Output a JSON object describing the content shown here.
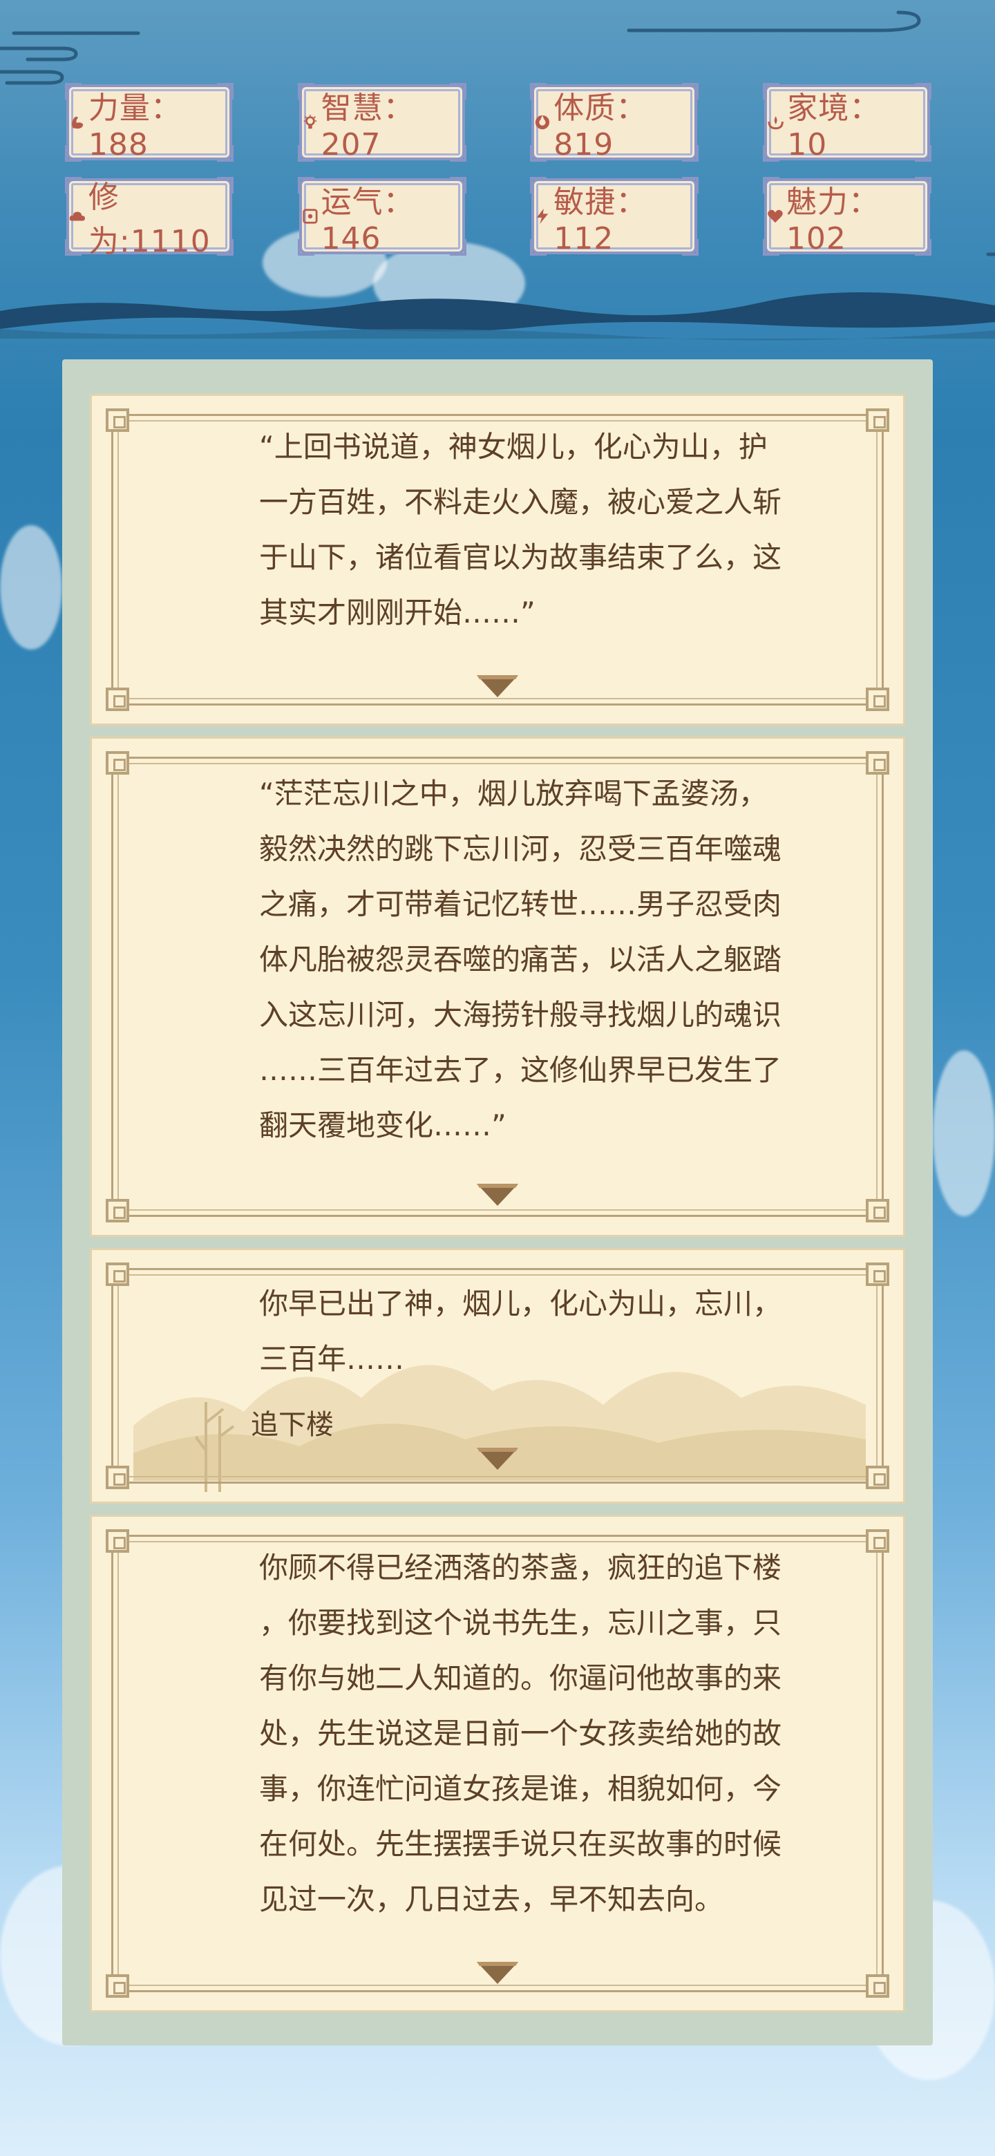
{
  "colors": {
    "accent": "#b65b4a",
    "text": "#5c4027",
    "card": "#fbf1d6",
    "border": "#8a96c6"
  },
  "stats": [
    {
      "icon": "strength-icon",
      "label": "力量",
      "value": "188",
      "text": "力量：188"
    },
    {
      "icon": "wisdom-icon",
      "label": "智慧",
      "value": "207",
      "text": "智慧：207"
    },
    {
      "icon": "constitution-icon",
      "label": "体质",
      "value": "819",
      "text": "体质：819"
    },
    {
      "icon": "family-icon",
      "label": "家境",
      "value": "10",
      "text": "家境： 10"
    },
    {
      "icon": "cultivation-icon",
      "label": "修为",
      "value": "1110",
      "text": "修为:1110"
    },
    {
      "icon": "luck-icon",
      "label": "运气",
      "value": "146",
      "text": "运气：146"
    },
    {
      "icon": "agility-icon",
      "label": "敏捷",
      "value": "112",
      "text": "敏捷：112"
    },
    {
      "icon": "charm-icon",
      "label": "魅力",
      "value": "102",
      "text": "魅力：102"
    }
  ],
  "story": [
    {
      "text": "“上回书说道，神女烟儿，化心为山，护\n一方百姓，不料走火入魔，被心爱之人斩\n于山下，诸位看官以为故事结束了么，这\n其实才刚刚开始……”"
    },
    {
      "text": "“茫茫忘川之中，烟儿放弃喝下孟婆汤，\n毅然决然的跳下忘川河，忍受三百年噬魂\n之痛，才可带着记忆转世……男子忍受肉\n体凡胎被怨灵吞噬的痛苦，以活人之躯踏\n入这忘川河，大海捞针般寻找烟儿的魂识\n……三百年过去了，这修仙界早已发生了\n翻天覆地变化……”"
    },
    {
      "text": "你早已出了神，烟儿，化心为山，忘川，\n三百年……",
      "choice": "追下楼"
    },
    {
      "text": "你顾不得已经洒落的茶盏，疯狂的追下楼\n，你要找到这个说书先生，忘川之事，只\n有你与她二人知道的。你逼问他故事的来\n处，先生说这是日前一个女孩卖给她的故\n事，你连忙问道女孩是谁，相貌如何，今\n在何处。先生摆摆手说只在买故事的时候\n见过一次，几日过去，早不知去向。"
    }
  ]
}
